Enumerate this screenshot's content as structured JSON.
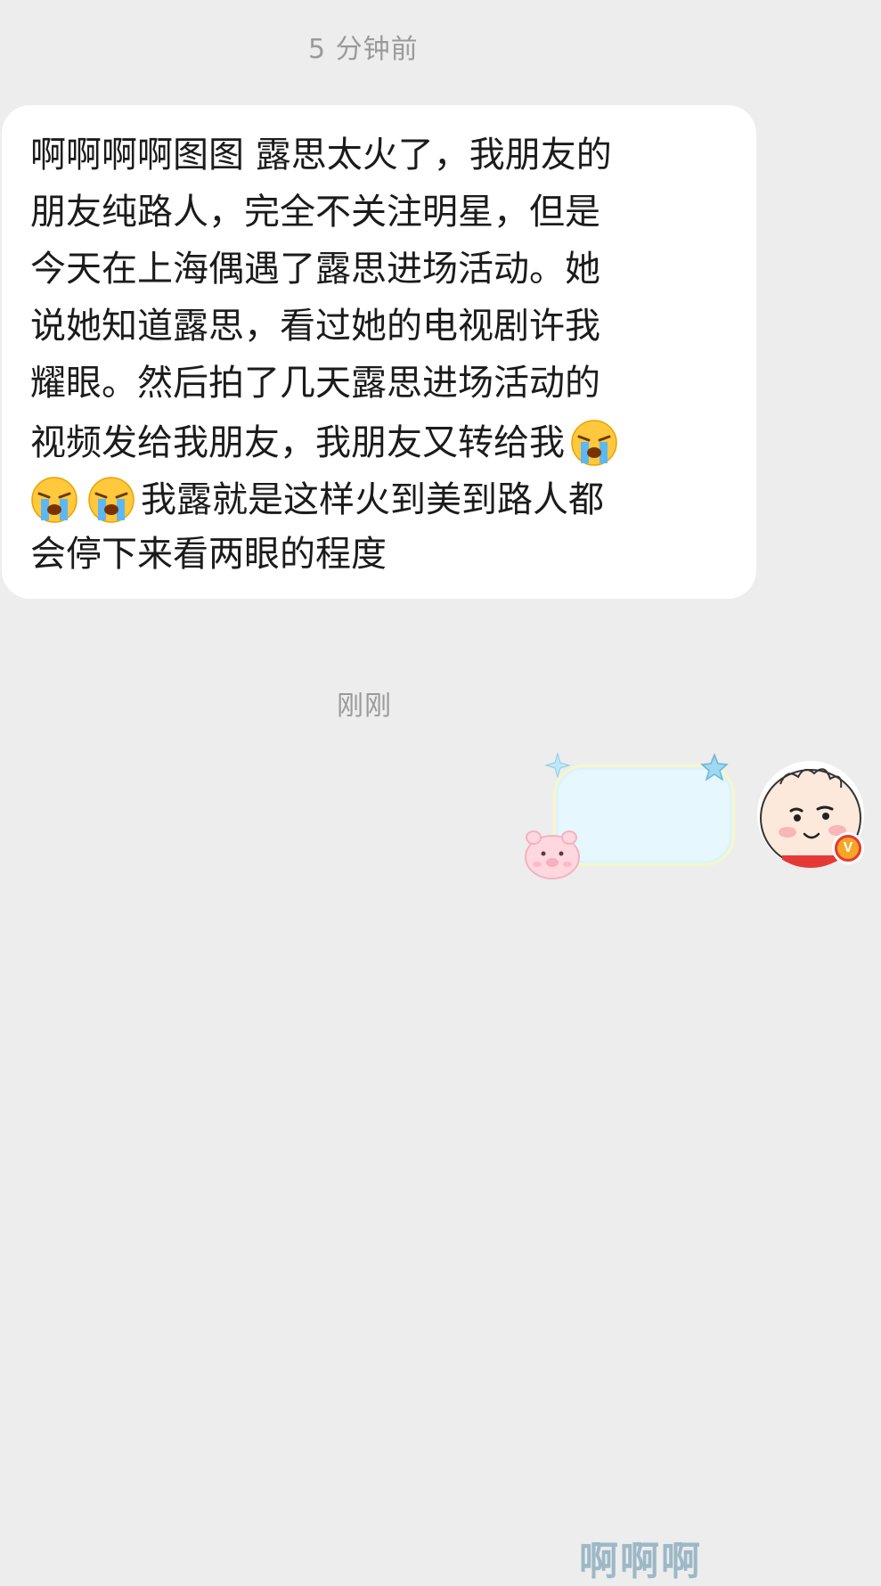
{
  "timestamps": {
    "first": "5 分钟前",
    "second": "刚刚"
  },
  "incoming_message": {
    "lines": [
      "啊啊啊啊图图 露思太火了，我朋友的",
      "朋友纯路人，完全不关注明星，但是",
      "今天在上海偶遇了露思进场活动。她",
      "说她知道露思，看过她的电视剧许我",
      "耀眼。然后拍了几天露思进场活动的",
      "视频发给我朋友，我朋友又转给我",
      "我露就是这样火到美到路人都",
      "会停下来看两眼的程度"
    ],
    "emoji": "loudly-crying-face"
  },
  "outgoing_message": {
    "sticker_text": "啊啊啊"
  },
  "colors": {
    "background": "#ededed",
    "bubble": "#ffffff",
    "timestamp": "#9a9a9a",
    "sticker_text": "#9db8c6",
    "verified_badge": "#f5a623"
  },
  "avatar": {
    "badge_letter": "V"
  }
}
